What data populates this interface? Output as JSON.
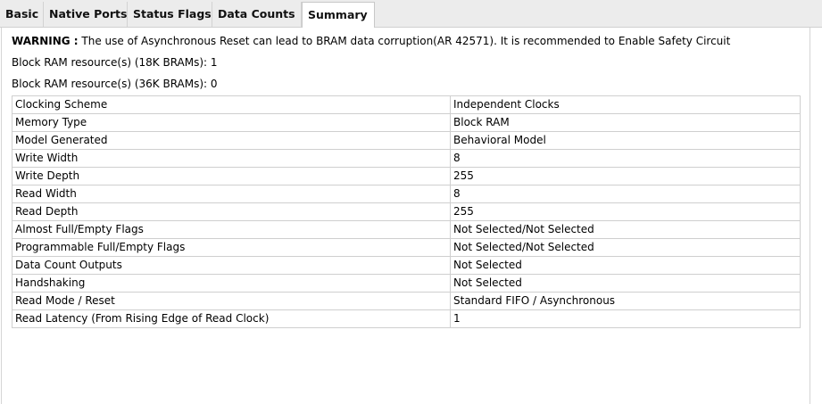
{
  "tabs": [
    {
      "label": "Basic"
    },
    {
      "label": "Native Ports"
    },
    {
      "label": "Status Flags"
    },
    {
      "label": "Data Counts"
    },
    {
      "label": "Summary"
    }
  ],
  "active_tab": "Summary",
  "warning": {
    "prefix": "WARNING :",
    "text": " The use of Asynchronous Reset can lead to BRAM data corruption(AR 42571). It is recommended to Enable Safety Circuit"
  },
  "bram_18k": "Block RAM resource(s) (18K BRAMs): 1",
  "bram_36k": "Block RAM resource(s) (36K BRAMs): 0",
  "summary": [
    {
      "key": "Clocking Scheme",
      "value": "Independent Clocks"
    },
    {
      "key": "Memory Type",
      "value": "Block RAM"
    },
    {
      "key": "Model Generated",
      "value": "Behavioral Model"
    },
    {
      "key": "Write Width",
      "value": "8"
    },
    {
      "key": "Write Depth",
      "value": "255"
    },
    {
      "key": "Read Width",
      "value": "8"
    },
    {
      "key": "Read Depth",
      "value": "255"
    },
    {
      "key": "Almost Full/Empty Flags",
      "value": "Not Selected/Not Selected"
    },
    {
      "key": "Programmable Full/Empty Flags",
      "value": "Not Selected/Not Selected"
    },
    {
      "key": "Data Count Outputs",
      "value": "Not Selected"
    },
    {
      "key": "Handshaking",
      "value": "Not Selected"
    },
    {
      "key": "Read Mode / Reset",
      "value": "Standard FIFO / Asynchronous"
    },
    {
      "key": "Read Latency (From Rising Edge of Read Clock)",
      "value": "1"
    }
  ]
}
